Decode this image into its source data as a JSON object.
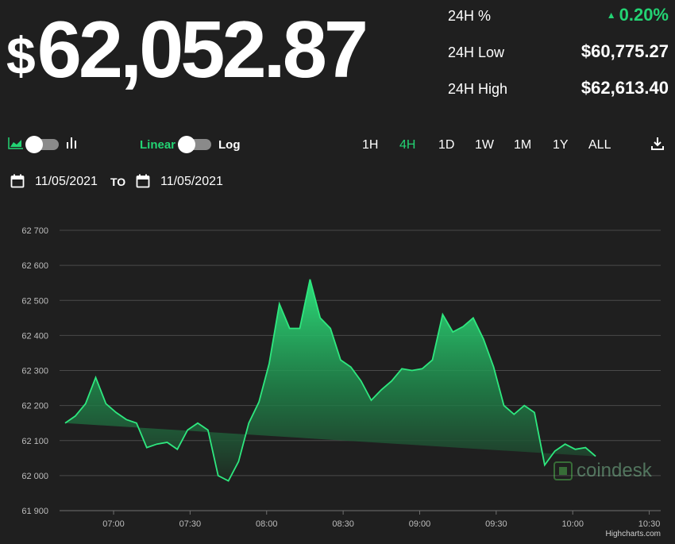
{
  "price": {
    "currency_symbol": "$",
    "value": "62,052.87"
  },
  "stats": [
    {
      "label": "24H %",
      "value": "0.20%",
      "direction": "up"
    },
    {
      "label": "24H Low",
      "value": "$60,775.27"
    },
    {
      "label": "24H High",
      "value": "$62,613.40"
    }
  ],
  "controls": {
    "scale_linear": "Linear",
    "scale_log": "Log",
    "ranges": [
      "1H",
      "4H",
      "1D",
      "1W",
      "1M",
      "1Y",
      "ALL"
    ],
    "active_range": "4H"
  },
  "dates": {
    "from": "11/05/2021",
    "to_label": "TO",
    "to": "11/05/2021"
  },
  "branding": {
    "watermark": "coindesk",
    "credits": "Highcharts.com"
  },
  "colors": {
    "accent": "#23d373",
    "line": "#2ee87f",
    "background": "#1f1f1f",
    "grid": "#4a4a4a"
  },
  "chart_data": {
    "type": "area",
    "ylim": [
      61900,
      62700
    ],
    "yticks": [
      61900,
      62000,
      62100,
      62200,
      62300,
      62400,
      62500,
      62600,
      62700
    ],
    "ytick_labels": [
      "61 900",
      "62 000",
      "62 100",
      "62 200",
      "62 300",
      "62 400",
      "62 500",
      "62 600",
      "62 700"
    ],
    "xticks": [
      "07:00",
      "07:30",
      "08:00",
      "08:30",
      "09:00",
      "09:30",
      "10:00",
      "10:30"
    ],
    "x": [
      "06:41",
      "06:45",
      "06:49",
      "06:53",
      "06:57",
      "07:01",
      "07:05",
      "07:09",
      "07:13",
      "07:17",
      "07:21",
      "07:25",
      "07:29",
      "07:33",
      "07:37",
      "07:41",
      "07:45",
      "07:49",
      "07:53",
      "07:57",
      "08:01",
      "08:05",
      "08:09",
      "08:13",
      "08:17",
      "08:21",
      "08:25",
      "08:29",
      "08:33",
      "08:37",
      "08:41",
      "08:45",
      "08:49",
      "08:53",
      "08:57",
      "09:01",
      "09:05",
      "09:09",
      "09:13",
      "09:17",
      "09:21",
      "09:25",
      "09:29",
      "09:33",
      "09:37",
      "09:41",
      "09:45",
      "09:49",
      "09:53",
      "09:57",
      "10:01",
      "10:05",
      "10:09",
      "10:13",
      "10:17",
      "10:21",
      "10:25",
      "10:29",
      "10:32"
    ],
    "values": [
      62150,
      62170,
      62205,
      62280,
      62205,
      62180,
      62160,
      62150,
      62080,
      62090,
      62095,
      62075,
      62130,
      62150,
      62130,
      62000,
      61985,
      62040,
      62150,
      62210,
      62320,
      62490,
      62420,
      62420,
      62560,
      62450,
      62420,
      62330,
      62310,
      62270,
      62215,
      62245,
      62270,
      62305,
      62300,
      62305,
      62330,
      62460,
      62410,
      62425,
      62450,
      62390,
      62310,
      62200,
      62175,
      62200,
      62180,
      62030,
      62070,
      62090,
      62075,
      62080,
      62055
    ],
    "series": [
      {
        "name": "",
        "values": []
      }
    ]
  }
}
